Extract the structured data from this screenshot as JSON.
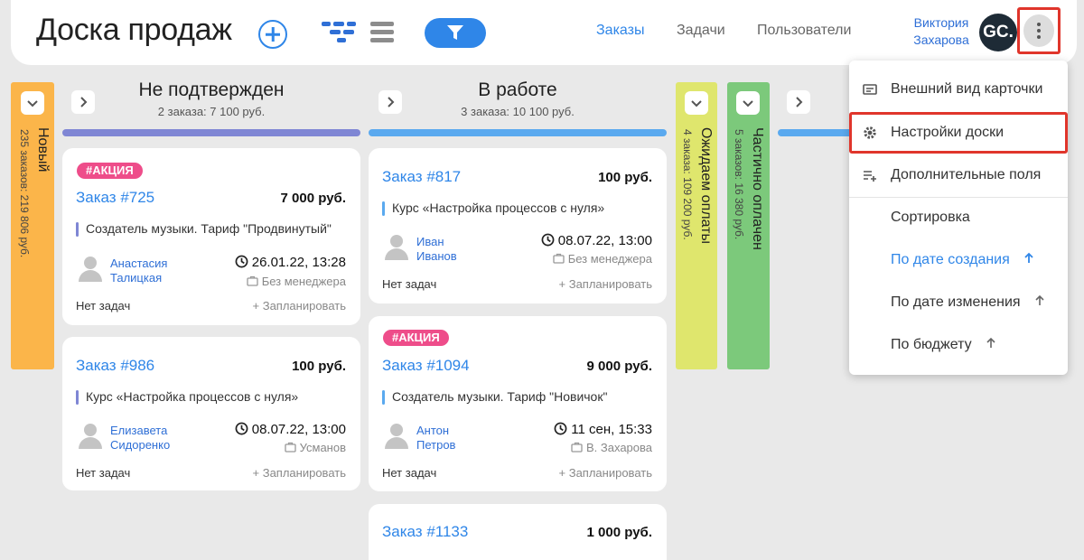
{
  "header": {
    "title": "Доска продаж",
    "nav": [
      "Заказы",
      "Задачи",
      "Пользователи"
    ],
    "user_name": "Виктория Захарова",
    "avatar_initials": "GC."
  },
  "columns_collapsed": [
    {
      "title": "Новый",
      "sub": "235 заказов: 219 806 руб.",
      "color": "#fbb54a"
    },
    {
      "title": "Ожидаем оплаты",
      "sub": "4 заказа: 109 200 руб.",
      "color": "#dfe66d"
    },
    {
      "title": "Частично оплачен",
      "sub": "5 заказов: 16 380 руб.",
      "color": "#7cc97b"
    }
  ],
  "columns": [
    {
      "title": "Не подтвержден",
      "sub": "2 заказа: 7 100 руб.",
      "color": "#7f86d4",
      "cards": [
        {
          "badge": "#АКЦИЯ",
          "order": "Заказ #725",
          "price": "7 000 руб.",
          "product": "Создатель музыки. Тариф \"Продвинутый\"",
          "person": [
            "Анастасия",
            "Талицкая"
          ],
          "date": "26.01.22, 13:28",
          "manager": "Без менеджера",
          "tasks": "Нет задач",
          "plan": "+ Запланировать"
        },
        {
          "order": "Заказ #986",
          "price": "100 руб.",
          "product": "Курс «Настройка процессов с нуля»",
          "person": [
            "Елизавета",
            "Сидоренко"
          ],
          "date": "08.07.22, 13:00",
          "manager": "Усманов",
          "tasks": "Нет задач",
          "plan": "+ Запланировать"
        }
      ]
    },
    {
      "title": "В работе",
      "sub": "3 заказа: 10 100 руб.",
      "color": "#5aa9ef",
      "cards": [
        {
          "order": "Заказ #817",
          "price": "100 руб.",
          "product": "Курс «Настройка процессов с нуля»",
          "person": [
            "Иван",
            "Иванов"
          ],
          "date": "08.07.22, 13:00",
          "manager": "Без менеджера",
          "tasks": "Нет задач",
          "plan": "+ Запланировать"
        },
        {
          "badge": "#АКЦИЯ",
          "order": "Заказ #1094",
          "price": "9 000 руб.",
          "product": "Создатель музыки. Тариф \"Новичок\"",
          "person": [
            "Антон",
            "Петров"
          ],
          "date": "11 сен, 15:33",
          "manager": "В. Захарова",
          "tasks": "Нет задач",
          "plan": "+ Запланировать"
        },
        {
          "order": "Заказ #1133",
          "price": "1 000 руб."
        }
      ]
    }
  ],
  "menu": {
    "items": [
      {
        "label": "Внешний вид карточки",
        "icon": "card-view-icon"
      },
      {
        "label": "Настройки доски",
        "icon": "gear-icon"
      },
      {
        "label": "Дополнительные поля",
        "icon": "add-fields-icon"
      }
    ],
    "sort_label": "Сортировка",
    "sort_options": [
      {
        "label": "По дате создания",
        "active": true
      },
      {
        "label": "По дате изменения",
        "active": false
      },
      {
        "label": "По бюджету",
        "active": false
      }
    ]
  },
  "colors": {
    "accent": "#2f86e8",
    "highlight": "#e0352b",
    "badge": "#ee4d8a"
  }
}
